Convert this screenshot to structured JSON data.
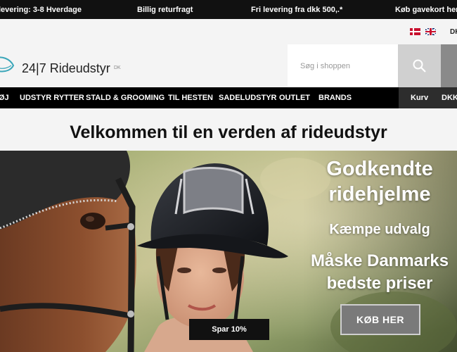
{
  "infobar": {
    "items": [
      "levering: 3-8 Hverdage",
      "Billig returfragt",
      "Fri levering fra dkk 500,.*",
      "Køb gavekort her"
    ]
  },
  "language": {
    "flags": [
      "denmark-flag-icon",
      "uk-flag-icon"
    ],
    "code": "DK"
  },
  "header": {
    "logo_text": "24|7 Rideudstyr",
    "logo_suffix": "DK",
    "search_placeholder": "Søg i shoppen"
  },
  "nav": {
    "items": [
      "ØJ",
      "UDSTYR RYTTER",
      "STALD & GROOMING",
      "TIL HESTEN",
      "SADELUDSTYR",
      "OUTLET",
      "BRANDS"
    ],
    "cart_label": "Kurv",
    "currency_label": "DKK"
  },
  "welcome": {
    "title": "Velkommen til en verden af rideudstyr"
  },
  "hero": {
    "line1": "Godkendte",
    "line2": "ridehjelme",
    "line3": "Kæmpe udvalg",
    "line4": "Måske Danmarks",
    "line5": "bedste priser",
    "cta_label": "KØB HER",
    "badge": "Spar 10%"
  },
  "colors": {
    "topbar": "#111111",
    "nav": "#000000",
    "accent_logo": "#3aa6b9",
    "search_button": "#d0d0d0"
  }
}
